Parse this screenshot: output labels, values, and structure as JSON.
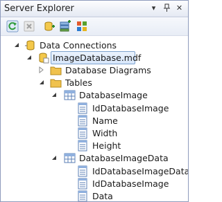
{
  "window": {
    "title": "Server Explorer",
    "pin_glyph": "⊥",
    "close_glyph": "✕",
    "dropdown_glyph": "▾"
  },
  "toolbar": {
    "buttons": [
      {
        "icon": "refresh-icon"
      },
      {
        "icon": "stop-icon"
      },
      {
        "icon": "connect-to-database-icon"
      },
      {
        "icon": "connect-to-server-icon"
      },
      {
        "icon": "sharepoint-connection-icon"
      }
    ]
  },
  "tree": {
    "data_connections": "Data Connections",
    "image_database": "ImageDatabase.mdf",
    "database_diagrams": "Database Diagrams",
    "tables": "Tables",
    "table1": {
      "name": "DatabaseImage",
      "columns": [
        "IdDatabaseImage",
        "Name",
        "Width",
        "Height"
      ]
    },
    "table2": {
      "name": "DatabaseImageData",
      "columns": [
        "IdDatabaseImageData",
        "IdDatabaseImage",
        "Data"
      ]
    }
  },
  "colors": {
    "border": "#8e9bbc",
    "selection_border": "#7da2ce",
    "folder": "#f0c24e",
    "table_grid": "#5b7fb6"
  }
}
